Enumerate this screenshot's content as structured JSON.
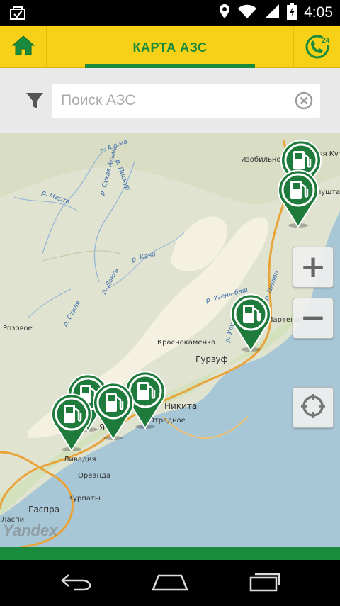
{
  "status_bar": {
    "time": "4:05",
    "icons": [
      "notification-check-icon",
      "location-icon",
      "wifi-icon",
      "signal-icon",
      "battery-icon"
    ]
  },
  "header": {
    "title": "КАРТА АЗС",
    "home_icon": "home-icon",
    "call_icon": "phone-24-icon",
    "call_badge": "24",
    "colors": {
      "background": "#f7d117",
      "accent": "#1a8a3c"
    }
  },
  "search": {
    "placeholder": "Поиск АЗС",
    "value": "",
    "filter_icon": "filter-icon",
    "clear_icon": "clear-icon"
  },
  "map": {
    "place_labels": [
      "Изобильное",
      "Алушта",
      "Краснокаменка",
      "Гурзуф",
      "Никита",
      "Ливадия",
      "Ореанда",
      "Курпаты",
      "Гаспра",
      "Партенит",
      "Ялта",
      "Нижняя Кутузовка",
      "Отрадное",
      "Розовое",
      "Ласпи"
    ],
    "river_labels": [
      "р. Альма",
      "р. Сухая Альма",
      "р. Пискур",
      "р. Марта",
      "р. Кача",
      "р. Донга",
      "р. Узень-баш",
      "р. Стиля",
      "р. Улу-Узень",
      "р. Шелен"
    ],
    "attribution": "Yandex",
    "zoom_in_label": "+",
    "zoom_out_label": "−",
    "locate_icon": "crosshair-icon",
    "station_icon": "fuel-pump-icon",
    "station_count": 7,
    "colors": {
      "pin": "#1f7b3c",
      "land": "#dfe3cf",
      "sea": "#a7c6d6",
      "road": "#e8a43a"
    }
  },
  "nav_bar": {
    "back_icon": "back-icon",
    "home_icon": "nav-home-icon",
    "recents_icon": "recents-icon"
  }
}
